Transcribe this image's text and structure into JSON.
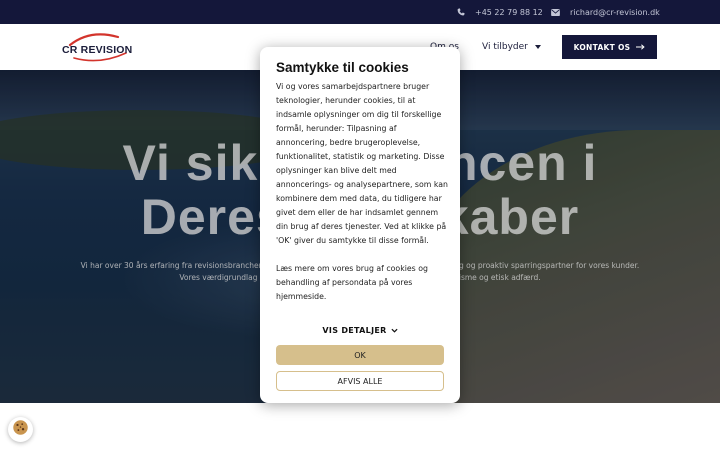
{
  "topbar": {
    "phone": "+45 22 79 88 12",
    "email": "richard@cr-revision.dk",
    "icons": [
      "phone-icon",
      "mail-icon"
    ]
  },
  "nav": {
    "logo_text": "CR REVISION",
    "about_label": "Om os",
    "offer_label": "Vi tilbyder",
    "contact_label": "KONTAKT OS"
  },
  "hero": {
    "title_line1": "Vi sikrer balancen i",
    "title_line2": "Deres regnskaber",
    "text": "Vi har over 30 års erfaring fra revisionsbranchen og sætter en ære i at være en kompetent, troværdig og proaktiv sparringspartner for vores kunder. Vores værdigrundlag bygger på faglighed, tillid, ordentlighed, professionalisme og etisk adfærd."
  },
  "cookie": {
    "title": "Samtykke til cookies",
    "body1": "Vi og vores samarbejdspartnere bruger teknologier, herunder cookies, til at indsamle oplysninger om dig til forskellige formål, herunder: Tilpasning af annoncering, bedre brugeroplevelse, funktionalitet, statistik og marketing. Disse oplysninger kan blive delt med annoncerings- og analysepartnere, som kan kombinere dem med data, du tidligere har givet dem eller de har indsamlet gennem din brug af deres tjenester. Ved at klikke på 'OK' giver du samtykke til disse formål.",
    "body2": "Læs mere om vores brug af cookies og behandling af persondata på vores hjemmeside.",
    "details_label": "VIS DETALJER",
    "ok_label": "OK",
    "reject_label": "AFVIS ALLE"
  },
  "colors": {
    "navy": "#14173a",
    "gold": "#d6bf8c",
    "logo_red": "#d3342c"
  }
}
